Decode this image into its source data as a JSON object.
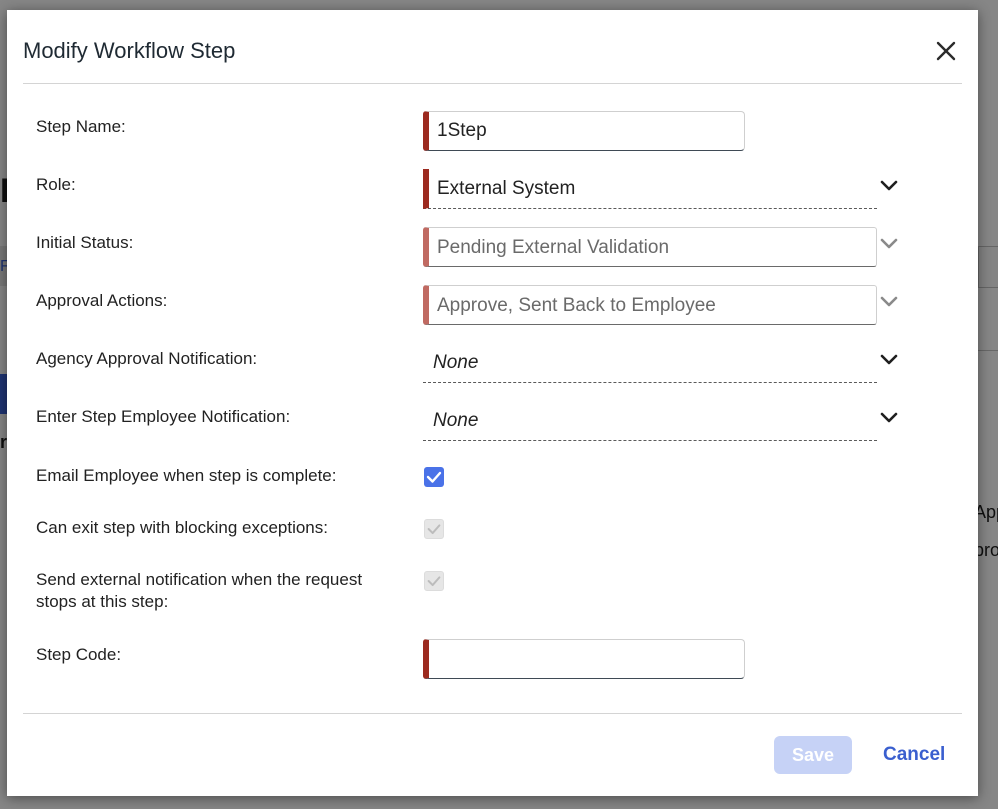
{
  "dialog": {
    "title": "Modify Workflow Step",
    "close_icon": "close-icon"
  },
  "fields": {
    "step_name": {
      "label": "Step Name:",
      "value": "1Step"
    },
    "role": {
      "label": "Role:",
      "value": "External System"
    },
    "initial_status": {
      "label": "Initial Status:",
      "value": "Pending External Validation"
    },
    "approval_actions": {
      "label": "Approval Actions:",
      "value": "Approve, Sent Back to Employee"
    },
    "agency_notification": {
      "label": "Agency Approval Notification:",
      "value": "None"
    },
    "enter_step_notification": {
      "label": "Enter Step Employee Notification:",
      "value": "None"
    },
    "email_employee": {
      "label": "Email Employee when step is complete:",
      "checked": true
    },
    "exit_blocking": {
      "label": "Can exit step with blocking exceptions:",
      "checked": true,
      "disabled": true
    },
    "external_notification": {
      "label": "Send external notification when the request stops at this step:",
      "checked": true,
      "disabled": true
    },
    "step_code": {
      "label": "Step Code:",
      "value": ""
    }
  },
  "footer": {
    "save_label": "Save",
    "cancel_label": "Cancel"
  },
  "background": {
    "frag_a": "K",
    "frag_b": "F",
    "frag_c": "r",
    "frag_d": "App",
    "frag_e": "pro"
  },
  "colors": {
    "required_marker": "#9c2a1f",
    "checkbox_checked": "#4a72e8",
    "link": "#3a5fcf",
    "save_disabled": "#c6d2f6"
  }
}
